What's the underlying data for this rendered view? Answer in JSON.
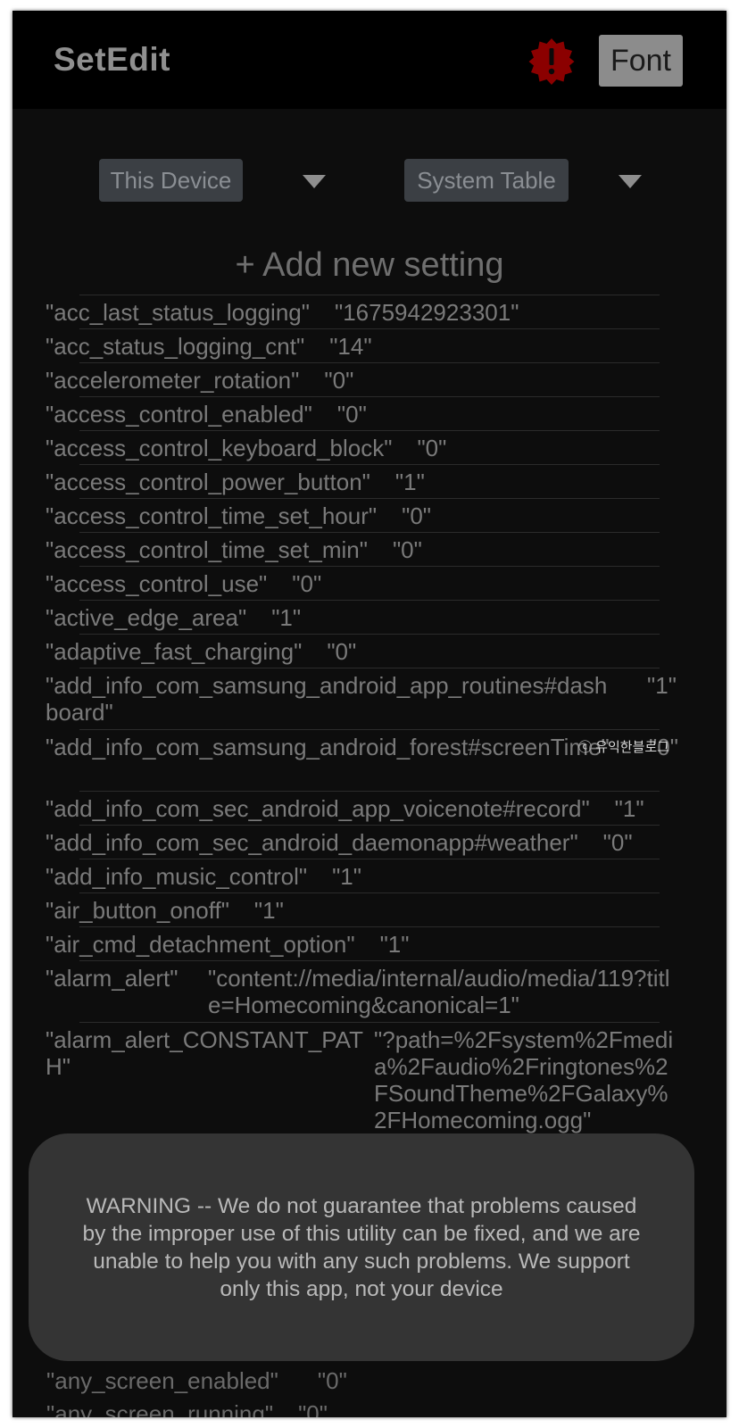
{
  "app": {
    "title": "SetEdit",
    "font_button": "Font"
  },
  "colors": {
    "alert_badge": "#8b0000",
    "background": "#0d0d0d"
  },
  "selectors": {
    "device": "This Device",
    "table": "System Table"
  },
  "add_setting_label": "+ Add new setting",
  "settings": [
    {
      "name": "\"acc_last_status_logging\"",
      "value": "\"1675942923301\""
    },
    {
      "name": "\"acc_status_logging_cnt\"",
      "value": "\"14\""
    },
    {
      "name": "\"accelerometer_rotation\"",
      "value": "\"0\""
    },
    {
      "name": "\"access_control_enabled\"",
      "value": "\"0\""
    },
    {
      "name": "\"access_control_keyboard_block\"",
      "value": "\"0\""
    },
    {
      "name": "\"access_control_power_button\"",
      "value": "\"1\""
    },
    {
      "name": "\"access_control_time_set_hour\"",
      "value": "\"0\""
    },
    {
      "name": "\"access_control_time_set_min\"",
      "value": "\"0\""
    },
    {
      "name": "\"access_control_use\"",
      "value": "\"0\""
    },
    {
      "name": "\"active_edge_area\"",
      "value": "\"1\""
    },
    {
      "name": "\"adaptive_fast_charging\"",
      "value": "\"0\""
    },
    {
      "name": "\"add_info_com_samsung_android_app_routines#dashboard\"",
      "value": "\"1\""
    },
    {
      "name": "\"add_info_com_samsung_android_forest#screenTime\"",
      "value": "\"0\""
    },
    {
      "name": "\"add_info_com_sec_android_app_voicenote#record\"",
      "value": "\"1\""
    },
    {
      "name": "\"add_info_com_sec_android_daemonapp#weather\"",
      "value": "\"0\""
    },
    {
      "name": "\"add_info_music_control\"",
      "value": "\"1\""
    },
    {
      "name": "\"air_button_onoff\"",
      "value": "\"1\""
    },
    {
      "name": "\"air_cmd_detachment_option\"",
      "value": "\"1\""
    },
    {
      "name": "\"alarm_alert\"",
      "value": "\"content://media/internal/audio/media/119?title=Homecoming&canonical=1\""
    },
    {
      "name": "\"alarm_alert_CONSTANT_PATH\"",
      "value": "\"?path=%2Fsystem%2Fmedia%2Faudio%2Fringtones%2FSoundTheme%2FGalaxy%2FHomecoming.ogg\""
    }
  ],
  "partial_rows": [
    {
      "name": "\"any_screen_enabled\"",
      "value": "\"0\""
    },
    {
      "name": "\"any_screen_running\"",
      "value": "\"0\""
    }
  ],
  "watermark": "ⓒ 유익한블로그",
  "toast": "WARNING -- We do not guarantee that problems caused by the improper use of this utility can be fixed, and we are unable to help you with any such problems. We support only this app, not your device"
}
